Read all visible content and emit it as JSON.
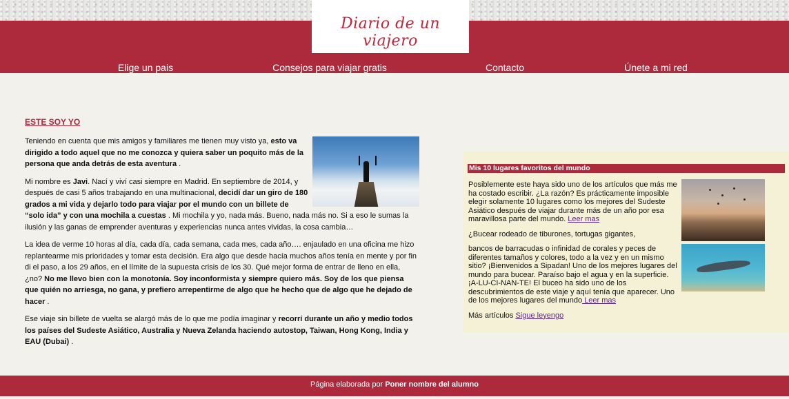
{
  "header": {
    "logo_text": "Diario de un viajero",
    "nav": [
      "Elige un pais",
      "Consejos para viajar gratis",
      "Contacto",
      "Únete a mi red"
    ]
  },
  "article": {
    "title": "Este soy yo",
    "p1": {
      "t1": "Teniendo en cuenta que mis amigos y familiares me tienen muy visto ya, ",
      "b1": "esto va dirigido a todo aquel que no me conozca y quiera saber un poquito más de la persona que anda detrás de esta aventura",
      "t2": " ."
    },
    "p2": {
      "t1": "Mi nombre es ",
      "b1": "Javi",
      "t2": ". Nací y viví casi siempre en Madrid. En septiembre de 2014, y después de casi 5 años trabajando en una multinacional, ",
      "b2": "decidí dar un giro de 180 grados a mi vida y dejarlo todo para viajar por el mundo con un billete de “solo ida” y con una mochila a cuestas",
      "t3": " . Mi mochila y yo, nada más. Bueno, nada más no. Si a eso le sumas la ilusión y las ganas de emprender aventuras y experiencias nunca antes vividas, la cosa cambia…"
    },
    "p3": {
      "t1": "La idea de verme 10 horas al día, cada día, cada semana, cada mes, cada año…. enjaulado en una oficina me hizo replantearme mis prioridades y tomar esta decisión. Era algo que desde hacía muchos años tenía en mente y por fin di el paso, a los 29 años, en el límite de la supuesta crisis de los 30. Qué mejor forma de entrar de lleno en ella, ¿no? ",
      "b1": "No me llevo bien con la monotonía. Soy inconformista y siempre quiero más. Soy de los que piensa que quién no arriesga, no gana, y prefiero arrepentirme de algo que he hecho que de algo que he dejado de hacer",
      "t2": " ."
    },
    "p4": {
      "t1": "Ese viaje sin billete de vuelta se alargó más de lo que me podía imaginar y ",
      "b1": "recorrí durante un año y medio todos los países del Sudeste Asiático, Australia y Nueva Zelanda haciendo autostop, Taiwan, Hong Kong, India y EAU (Dubai)",
      "t2": " ."
    }
  },
  "sidebar": {
    "title": "Mis 10 lugares favoritos del mundo",
    "p1": "Posiblemente este haya sido uno de los artículos que más me ha costado escribir. ¿La razón? Es prácticamente imposible elegir solamente 10 lugares como los mejores del Sudeste Asiático después de viajar durante más de un año por esa maravillosa parte del mundo. ",
    "p1_link": "Leer mas",
    "p2": "¿Bucear rodeado de tiburones, tortugas gigantes,",
    "p3": "bancos de barracudas o infinidad de corales y peces de diferentes tamaños y colores, todo a la vez y en un mismo sitio? ¡Bienvenidos a Sipadan! Uno de los mejores lugares del mundo para bucear. Paraíso bajo el agua y en la superficie. ¡A-LU-CI-NAN-TE! El buceo ha sido uno de los descubrimientos de este viaje y aquí tenía que aparecer. Uno de los mejores lugares del mundo",
    "p3_link": " Leer mas",
    "more_label": "Más artículos ",
    "more_link": "Sigue leyengo"
  },
  "footer": {
    "text": "Página elaborada por ",
    "author": "Poner nombre del alumno"
  },
  "colors": {
    "brand": "#ad2a3d",
    "background": "#f2f1ec",
    "sidebar_bg": "#f4f1d6",
    "link": "#5a2a86"
  }
}
